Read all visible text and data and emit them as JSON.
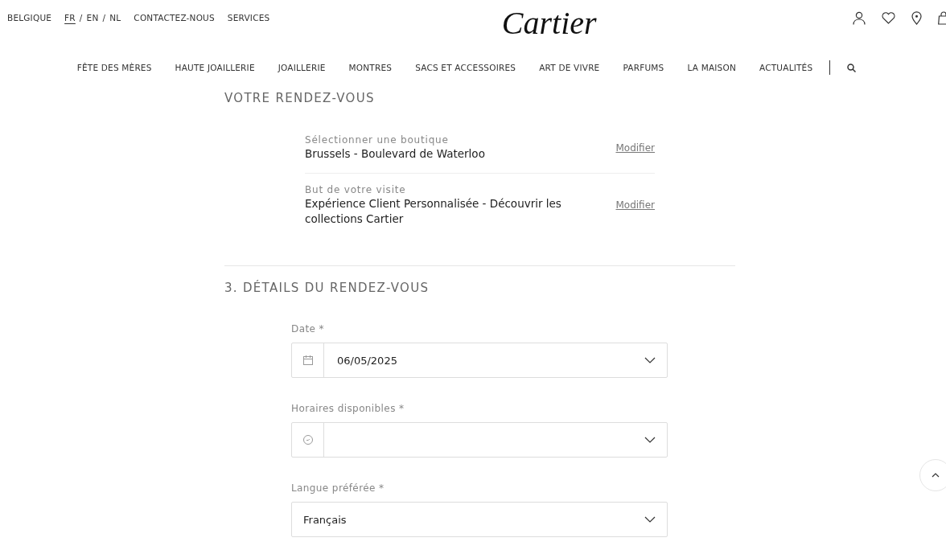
{
  "topbar": {
    "country": "BELGIQUE",
    "languages": [
      {
        "label": "FR",
        "selected": true
      },
      {
        "label": "EN",
        "selected": false
      },
      {
        "label": "NL",
        "selected": false
      }
    ],
    "separator": "/",
    "links": [
      "CONTACTEZ-NOUS",
      "SERVICES"
    ],
    "logo": "Cartier"
  },
  "nav": [
    "FÊTE DES MÈRES",
    "HAUTE JOAILLERIE",
    "JOAILLERIE",
    "MONTRES",
    "SACS ET ACCESSOIRES",
    "ART DE VIVRE",
    "PARFUMS",
    "LA MAISON",
    "ACTUALITÉS"
  ],
  "summary": {
    "title": "VOTRE RENDEZ-VOUS",
    "items": [
      {
        "label": "Sélectionner une boutique",
        "value": "Brussels - Boulevard de Waterloo",
        "action": "Modifier"
      },
      {
        "label": "But de votre visite",
        "value": "Expérience Client Personnalisée - Découvrir les collections Cartier",
        "action": "Modifier"
      }
    ]
  },
  "details": {
    "title": "3. DÉTAILS DU RENDEZ-VOUS",
    "fields": [
      {
        "kind": "date",
        "label": "Date *",
        "value": "06/05/2025"
      },
      {
        "kind": "time",
        "label": "Horaires disponibles *"
      },
      {
        "kind": "select",
        "label": "Langue préférée *",
        "value": "Français"
      }
    ]
  }
}
